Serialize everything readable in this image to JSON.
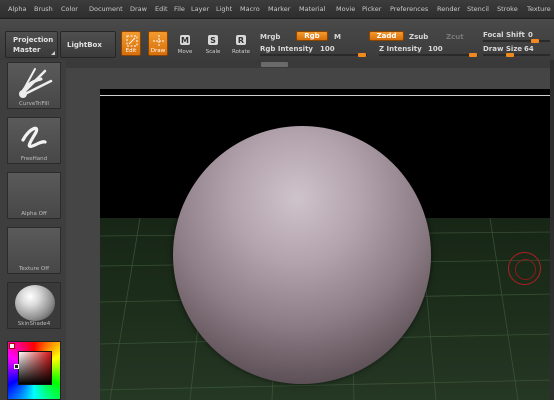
{
  "menu": [
    "Alpha",
    "Brush",
    "Color",
    "Document",
    "Draw",
    "Edit",
    "File",
    "Layer",
    "Light",
    "Macro",
    "Marker",
    "Material",
    "Movie",
    "Picker",
    "Preferences",
    "Render",
    "Stencil",
    "Stroke",
    "Texture"
  ],
  "toolbar": {
    "projection_master_line1": "Projection",
    "projection_master_line2": "Master",
    "lightbox": "LightBox",
    "edit": "Edit",
    "draw": "Draw",
    "move": "Move",
    "scale": "Scale",
    "rotate": "Rotate",
    "move_key": "M",
    "scale_key": "S",
    "rotate_key": "R",
    "mrgb": "Mrgb",
    "rgb": "Rgb",
    "m": "M",
    "zadd": "Zadd",
    "zsub": "Zsub",
    "zcut": "Zcut",
    "rgb_intensity_label": "Rgb Intensity",
    "rgb_intensity_value": "100",
    "z_intensity_label": "Z Intensity",
    "z_intensity_value": "100",
    "focal_shift_label": "Focal Shift",
    "focal_shift_value": "0",
    "draw_size_label": "Draw Size",
    "draw_size_value": "64"
  },
  "tray": {
    "brush": "CurveTriFill",
    "stroke": "FreeHand",
    "alpha": "Alpha Off",
    "texture": "Texture Off",
    "material": "SkinShade4"
  },
  "colors": {
    "accent": "#e8821a",
    "sphere": "#b3a3ac",
    "floor": "#1c2c1a"
  }
}
